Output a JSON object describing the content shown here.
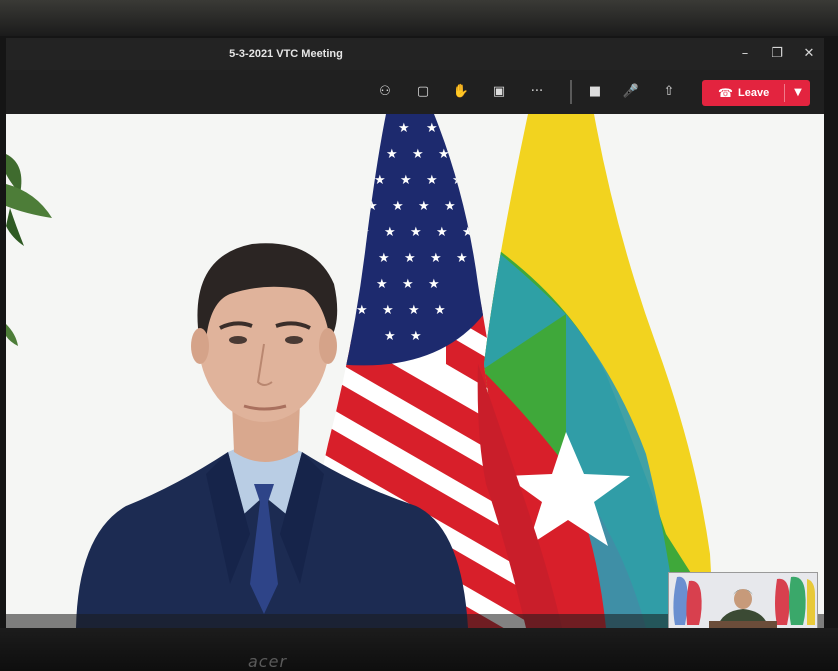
{
  "window": {
    "title": "5-3-2021 VTC Meeting",
    "controls": [
      "–",
      "❐",
      "✕"
    ]
  },
  "toolbar": {
    "buttons": [
      {
        "name": "people-icon",
        "glyph": "⚇"
      },
      {
        "name": "chat-icon",
        "glyph": "▢"
      },
      {
        "name": "raise-hand-icon",
        "glyph": "✋"
      },
      {
        "name": "rooms-icon",
        "glyph": "▣"
      },
      {
        "name": "more-icon",
        "glyph": "···"
      },
      {
        "name": "camera-icon",
        "glyph": "■"
      },
      {
        "name": "mic-icon",
        "glyph": "🎤"
      },
      {
        "name": "share-icon",
        "glyph": "⇧"
      }
    ],
    "leave": {
      "label": "Leave",
      "color": "#e3243f"
    }
  },
  "monitor": {
    "brand": "acer"
  }
}
